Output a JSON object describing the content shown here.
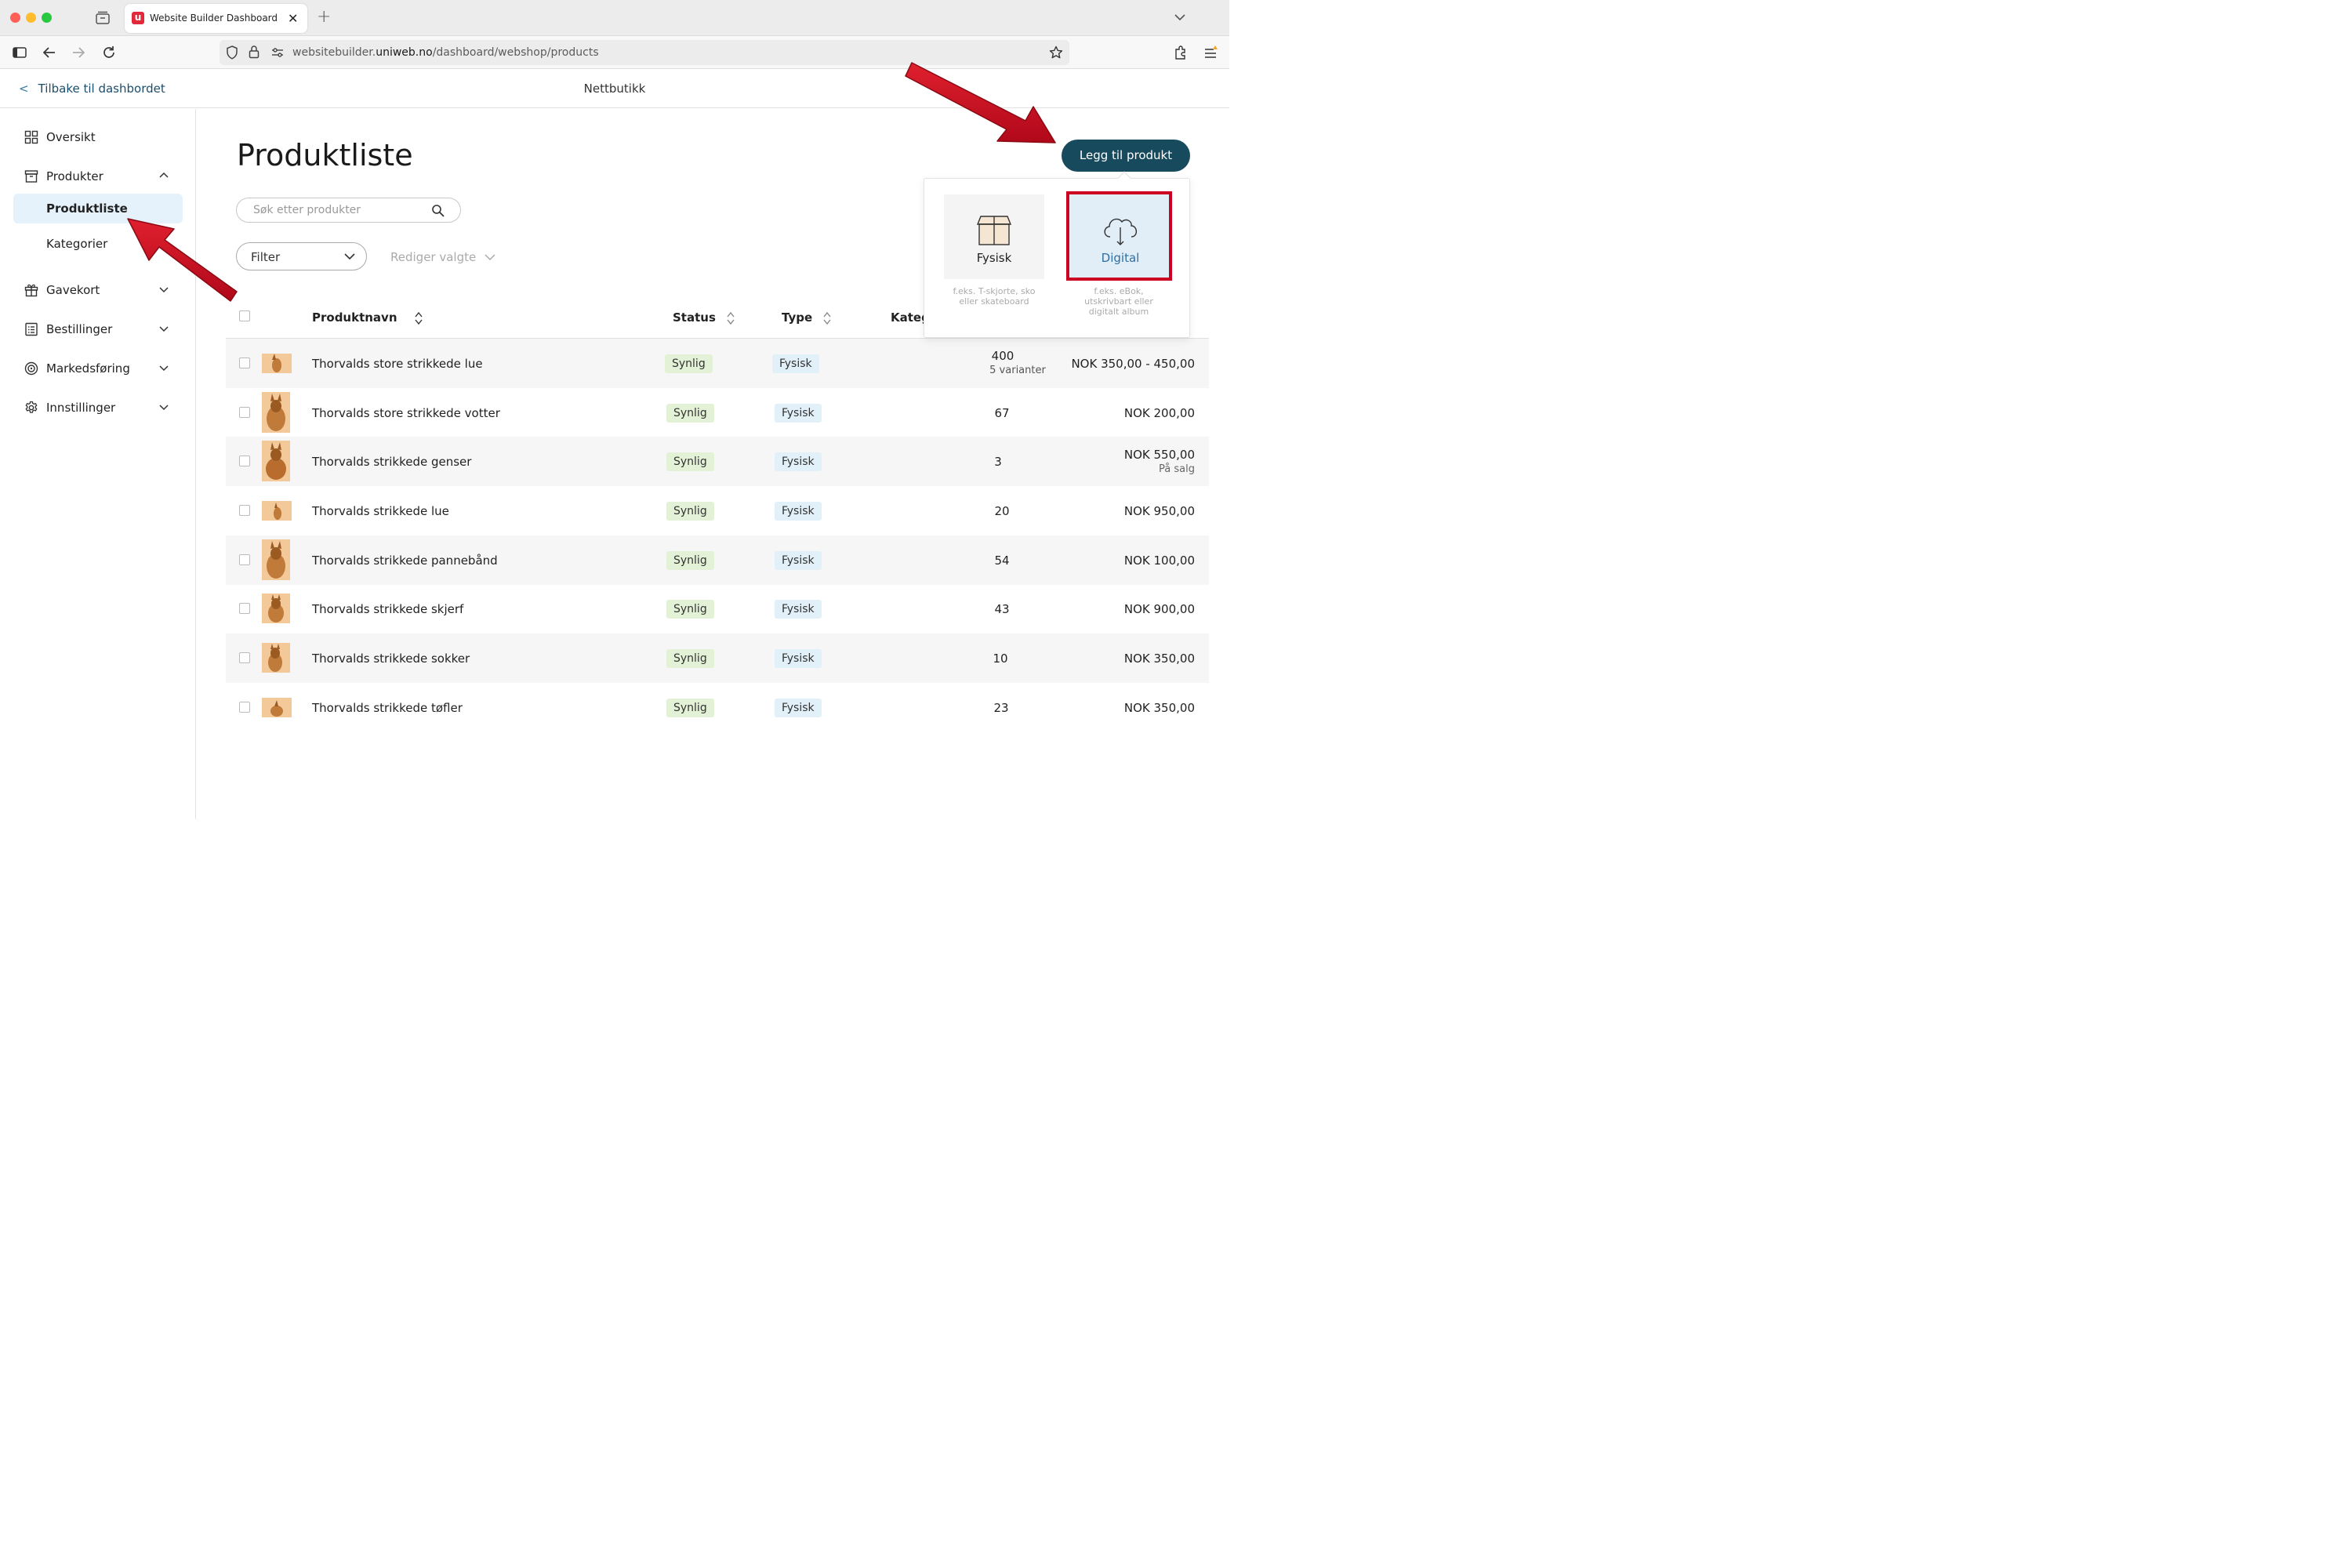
{
  "browser": {
    "tab_title": "Website Builder Dashboard",
    "tab_favicon": "u",
    "url_prefix": "websitebuilder.",
    "url_domain": "uniweb.no",
    "url_path": "/dashboard/webshop/products"
  },
  "header": {
    "back_label": "Tilbake til dashbordet",
    "title": "Nettbutikk"
  },
  "sidebar": {
    "items": [
      {
        "label": "Oversikt",
        "icon": "grid-icon"
      },
      {
        "label": "Produkter",
        "icon": "box-icon"
      },
      {
        "label": "Gavekort",
        "icon": "gift-icon"
      },
      {
        "label": "Bestillinger",
        "icon": "list-icon"
      },
      {
        "label": "Markedsføring",
        "icon": "target-icon"
      },
      {
        "label": "Innstillinger",
        "icon": "gear-icon"
      }
    ],
    "sub_items": [
      {
        "label": "Produktliste"
      },
      {
        "label": "Kategorier"
      }
    ]
  },
  "main": {
    "title": "Produktliste",
    "search_placeholder": "Søk etter produkter",
    "filter_label": "Filter",
    "bulk_label": "Rediger valgte",
    "add_button": "Legg til produkt"
  },
  "add_menu": {
    "physical_label": "Fysisk",
    "physical_desc_1": "f.eks. T-skjorte, sko",
    "physical_desc_2": "eller skateboard",
    "digital_label": "Digital",
    "digital_desc_1": "f.eks. eBok,",
    "digital_desc_2": "utskrivbart eller",
    "digital_desc_3": "digitalt album"
  },
  "table": {
    "columns": [
      "Produktnavn",
      "Status",
      "Type",
      "Kateg"
    ],
    "rows": [
      {
        "name": "Thorvalds store strikkede lue",
        "status": "Synlig",
        "type": "Fysisk",
        "stock": "400",
        "stock_sub": "5 varianter",
        "price": "NOK 350,00 - 450,00",
        "price_sub": ""
      },
      {
        "name": "Thorvalds store strikkede votter",
        "status": "Synlig",
        "type": "Fysisk",
        "stock": "67",
        "stock_sub": "",
        "price": "NOK 200,00",
        "price_sub": ""
      },
      {
        "name": "Thorvalds strikkede genser",
        "status": "Synlig",
        "type": "Fysisk",
        "stock": "3",
        "stock_sub": "",
        "price": "NOK 550,00",
        "price_sub": "På salg"
      },
      {
        "name": "Thorvalds strikkede lue",
        "status": "Synlig",
        "type": "Fysisk",
        "stock": "20",
        "stock_sub": "",
        "price": "NOK 950,00",
        "price_sub": ""
      },
      {
        "name": "Thorvalds strikkede pannebånd",
        "status": "Synlig",
        "type": "Fysisk",
        "stock": "54",
        "stock_sub": "",
        "price": "NOK 100,00",
        "price_sub": ""
      },
      {
        "name": "Thorvalds strikkede skjerf",
        "status": "Synlig",
        "type": "Fysisk",
        "stock": "43",
        "stock_sub": "",
        "price": "NOK 900,00",
        "price_sub": ""
      },
      {
        "name": "Thorvalds strikkede sokker",
        "status": "Synlig",
        "type": "Fysisk",
        "stock": "10",
        "stock_sub": "",
        "price": "NOK 350,00",
        "price_sub": ""
      },
      {
        "name": "Thorvalds strikkede tøfler",
        "status": "Synlig",
        "type": "Fysisk",
        "stock": "23",
        "stock_sub": "",
        "price": "NOK 350,00",
        "price_sub": ""
      }
    ]
  },
  "colors": {
    "accent": "#184a5e",
    "annotation_red": "#cc0022",
    "status_green": "#e3f2d6",
    "type_blue": "#e2f0f9"
  }
}
